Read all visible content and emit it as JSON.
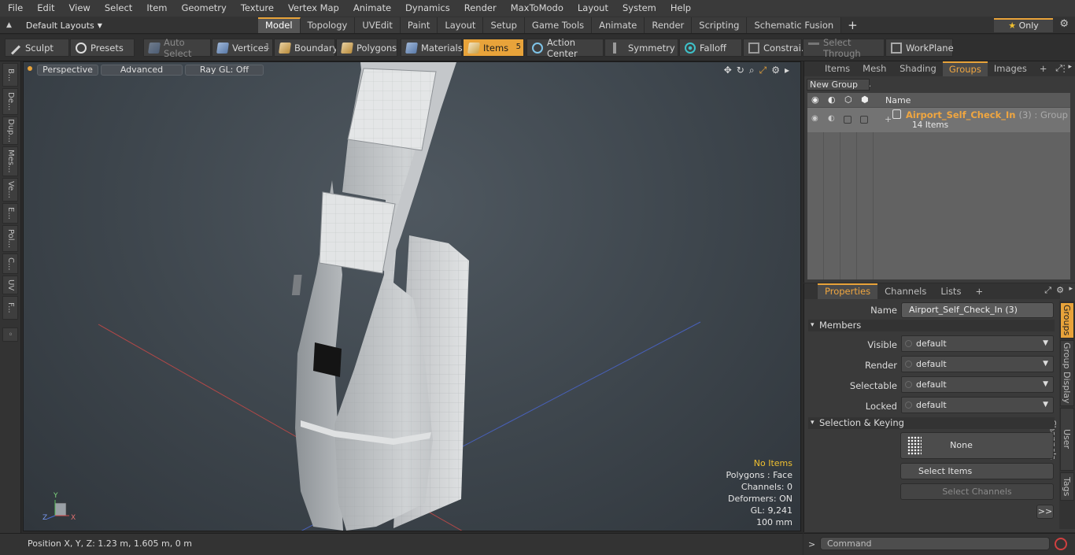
{
  "menu": [
    "File",
    "Edit",
    "View",
    "Select",
    "Item",
    "Geometry",
    "Texture",
    "Vertex Map",
    "Animate",
    "Dynamics",
    "Render",
    "MaxToModo",
    "Layout",
    "System",
    "Help"
  ],
  "layout_selector": "Default Layouts",
  "mode_tabs": [
    "Model",
    "Topology",
    "UVEdit",
    "Paint",
    "Layout",
    "Setup",
    "Game Tools",
    "Animate",
    "Render",
    "Scripting",
    "Schematic Fusion"
  ],
  "active_tab": "Model",
  "only_label": "Only",
  "toolbar": {
    "sculpt": "Sculpt",
    "presets": "Presets",
    "auto_select": "Auto Select",
    "vertices": "Vertices",
    "vertices_count": "1",
    "boundary": "Boundary",
    "polygons": "Polygons",
    "materials": "Materials",
    "items": "Items",
    "items_count": "5",
    "action_center": "Action Center",
    "symmetry": "Symmetry",
    "falloff": "Falloff",
    "constraints": "Constrai...",
    "select_through": "Select Through",
    "workplane": "WorkPlane"
  },
  "left_tabs": [
    "B...",
    "De...",
    "Dup...",
    "Mes...",
    "Ve...",
    "E...",
    "Pol...",
    "C...",
    "UV",
    "F..."
  ],
  "viewport": {
    "view_mode": "Perspective",
    "shading": "Advanced",
    "raygl": "Ray GL: Off",
    "info": {
      "items": "No Items",
      "polygons": "Polygons : Face",
      "channels": "Channels: 0",
      "deformers": "Deformers: ON",
      "gl": "GL: 9,241",
      "scale": "100 mm"
    },
    "axis_x": "X",
    "axis_y": "Y",
    "axis_z": "Z"
  },
  "top_panel": {
    "tabs": [
      "Items",
      "Mesh ...",
      "Shading",
      "Groups",
      "Images"
    ],
    "active_tab": "Groups",
    "new_group": "New Group",
    "col_name": "Name",
    "group": {
      "name": "Airport_Self_Check_In",
      "suffix": "(3) : Group",
      "items": "14 Items"
    }
  },
  "properties": {
    "tabs": [
      "Properties",
      "Channels",
      "Lists"
    ],
    "active_tab": "Properties",
    "side_tabs": [
      "Groups",
      "Group Display",
      "User Channels",
      "Tags"
    ],
    "name_label": "Name",
    "name_value": "Airport_Self_Check_In (3)",
    "members_section": "Members",
    "visible_label": "Visible",
    "visible_value": "default",
    "render_label": "Render",
    "render_value": "default",
    "selectable_label": "Selectable",
    "selectable_value": "default",
    "locked_label": "Locked",
    "locked_value": "default",
    "keying_section": "Selection & Keying",
    "none_label": "None",
    "select_items": "Select Items",
    "select_channels": "Select Channels",
    "more": ">>"
  },
  "status": {
    "position": "Position X, Y, Z:   1.23 m, 1.605 m, 0 m"
  },
  "command": {
    "placeholder": "Command"
  },
  "colors": {
    "accent": "#e8a33a",
    "group_name": "#f0a640",
    "warning_text": "#f0c030"
  }
}
